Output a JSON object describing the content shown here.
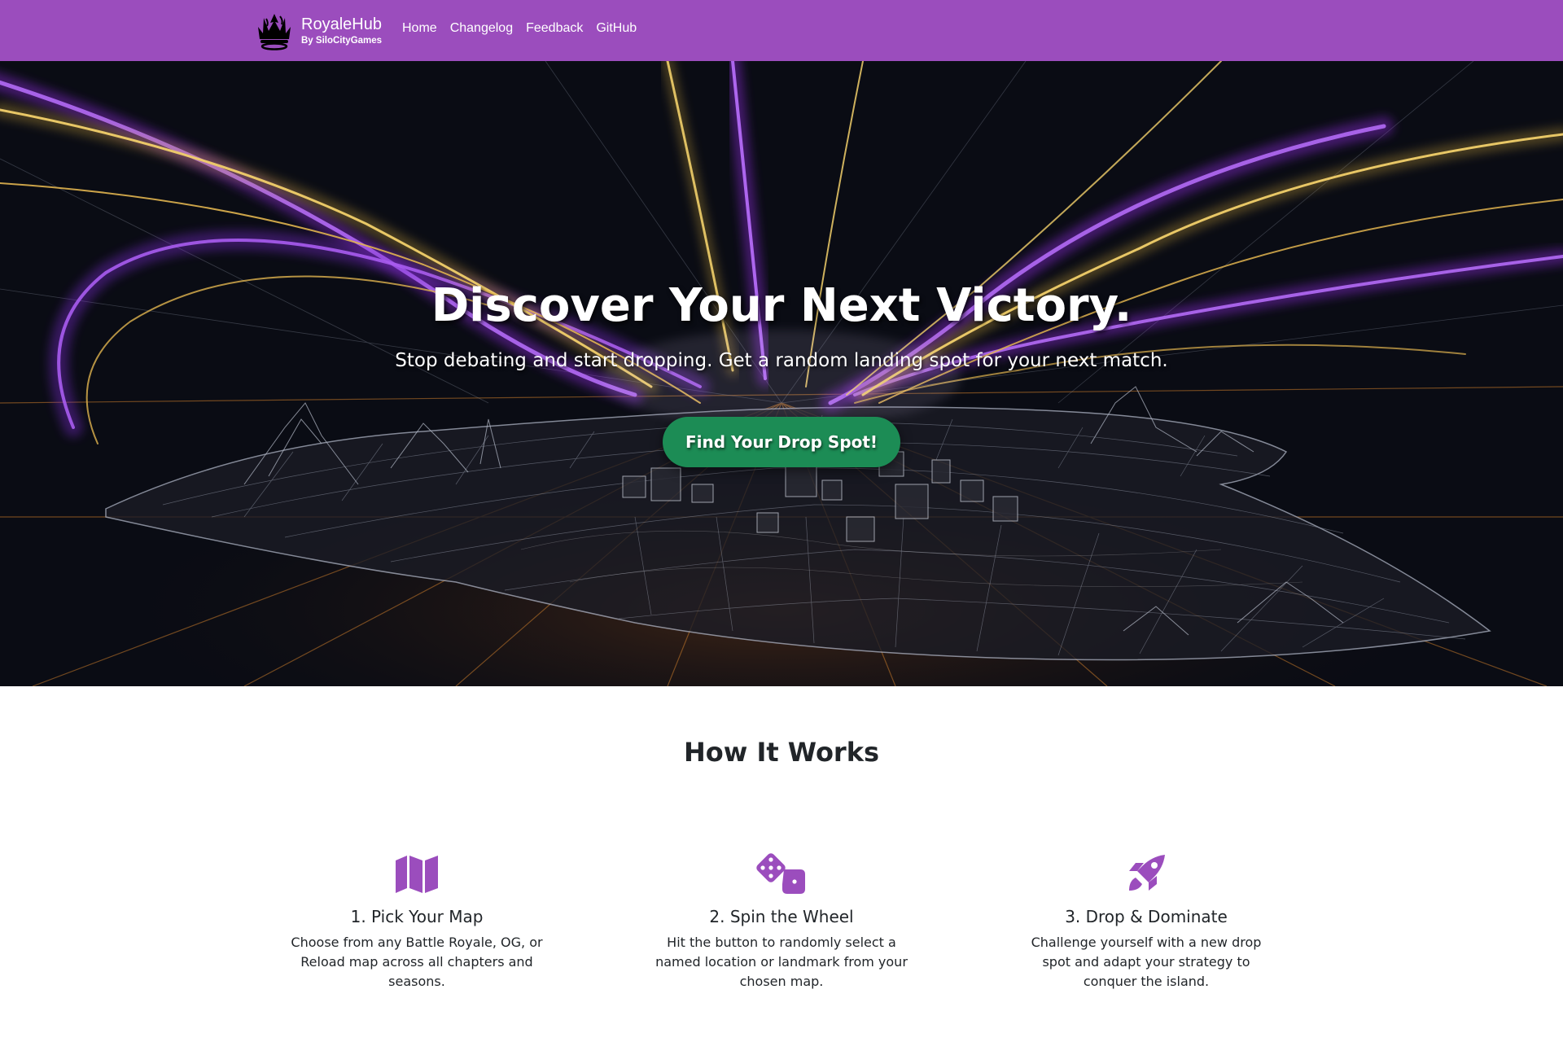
{
  "navbar": {
    "brand_name": "RoyaleHub",
    "brand_sub": "By SiloCityGames",
    "logo_icon": "crown-icon",
    "links": [
      "Home",
      "Changelog",
      "Feedback",
      "GitHub"
    ],
    "background": "#9b4dbd"
  },
  "hero": {
    "title": "Discover Your Next Victory.",
    "subtitle": "Stop debating and start dropping. Get a random landing spot for your next match.",
    "cta_label": "Find Your Drop Spot!",
    "cta_color": "#1c8c55",
    "background_image": "wireframe-island-with-light-trails"
  },
  "how_it_works": {
    "title": "How It Works",
    "icon_color": "#9b4dbd",
    "steps": [
      {
        "icon": "map-icon",
        "title": "1. Pick Your Map",
        "desc": "Choose from any Battle Royale, OG, or Reload map across all chapters and seasons."
      },
      {
        "icon": "dice-icon",
        "title": "2. Spin the Wheel",
        "desc": "Hit the button to randomly select a named location or landmark from your chosen map."
      },
      {
        "icon": "rocket-icon",
        "title": "3. Drop & Dominate",
        "desc": "Challenge yourself with a new drop spot and adapt your strategy to conquer the island."
      }
    ]
  }
}
